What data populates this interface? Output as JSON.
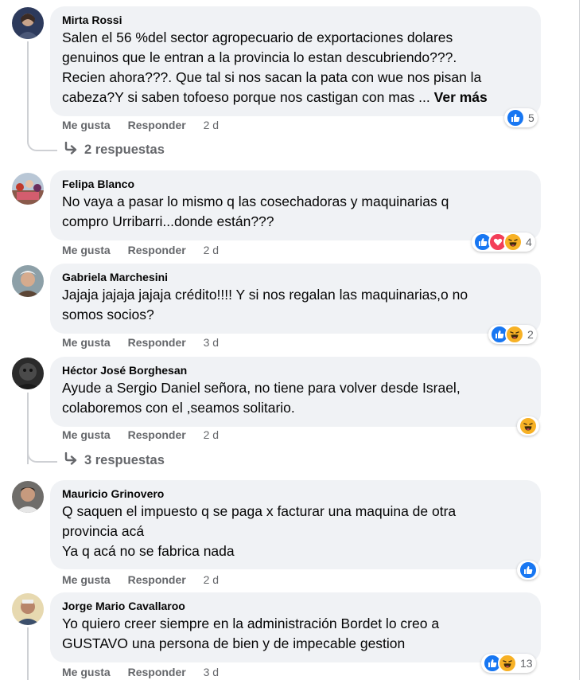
{
  "comments": [
    {
      "author": "Mirta Rossi",
      "lines": [
        "Salen el 56 %del sector agropecuario de exportaciones dolares",
        "genuinos que le entran a la provincia lo estan descubriendo???.",
        "Recien ahora???. Que tal si nos sacan la pata con wue nos pisan la",
        "cabeza?Y si saben tofoeso porque nos castigan con mas ... "
      ],
      "see_more": "Ver más",
      "like_label": "Me gusta",
      "reply_label": "Responder",
      "time": "2 d",
      "reactions": [
        "like"
      ],
      "reaction_count": "5",
      "replies_label": "2 respuestas"
    },
    {
      "author": "Felipa Blanco",
      "lines": [
        "No vaya a pasar lo mismo q las cosechadoras y maquinarias q",
        "compro Urribarri...donde están???"
      ],
      "like_label": "Me gusta",
      "reply_label": "Responder",
      "time": "2 d",
      "reactions": [
        "like",
        "love",
        "haha"
      ],
      "reaction_count": "4"
    },
    {
      "author": "Gabriela Marchesini",
      "lines": [
        "Jajaja jajaja jajaja crédito!!!! Y si nos regalan las maquinarias,o no",
        "somos socios?"
      ],
      "like_label": "Me gusta",
      "reply_label": "Responder",
      "time": "3 d",
      "reactions": [
        "like",
        "haha"
      ],
      "reaction_count": "2"
    },
    {
      "author": "Héctor José Borghesan",
      "lines": [
        "Ayude a Sergio Daniel señora, no tiene para volver desde Israel,",
        "colaboremos con el ,seamos solitario."
      ],
      "like_label": "Me gusta",
      "reply_label": "Responder",
      "time": "2 d",
      "reactions": [
        "haha"
      ],
      "reaction_count": "",
      "replies_label": "3 respuestas"
    },
    {
      "author": "Mauricio Grinovero",
      "lines": [
        "Q saquen el impuesto q se paga x facturar una maquina de otra",
        "provincia acá",
        "Ya q acá no se fabrica nada"
      ],
      "like_label": "Me gusta",
      "reply_label": "Responder",
      "time": "2 d",
      "reactions": [
        "like"
      ],
      "reaction_count": ""
    },
    {
      "author": "Jorge Mario Cavallaroo",
      "lines": [
        "Yo quiero creer siempre en la administración Bordet lo creo a",
        "GUSTAVO una persona de bien y de impecable gestion"
      ],
      "like_label": "Me gusta",
      "reply_label": "Responder",
      "time": "3 d",
      "reactions": [
        "like",
        "haha"
      ],
      "reaction_count": "13"
    }
  ],
  "colors": {
    "like": "#1877f2",
    "love": "#f33e58",
    "haha": "#f7b125",
    "bubble": "#f0f2f5",
    "secondary_text": "#65676b"
  },
  "icons": {
    "like": "thumbs-up-icon",
    "love": "heart-icon",
    "haha": "laughing-face-icon",
    "reply_arrow": "reply-arrow-icon"
  }
}
